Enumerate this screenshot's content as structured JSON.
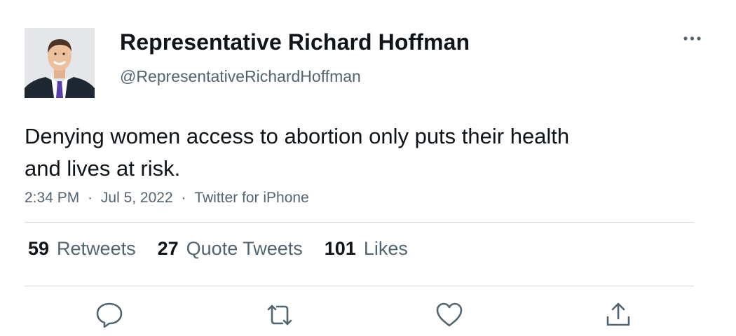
{
  "tweet": {
    "author": {
      "display_name": "Representative Richard Hoffman",
      "handle": "@RepresentativeRichardHoffman"
    },
    "text": "Denying women access to abortion only puts their health and lives at risk.",
    "time": "2:34 PM",
    "separator": "·",
    "date": "Jul 5, 2022",
    "source": "Twitter for iPhone",
    "stats": [
      {
        "count": "59",
        "label": "Retweets"
      },
      {
        "count": "27",
        "label": "Quote Tweets"
      },
      {
        "count": "101",
        "label": "Likes"
      }
    ],
    "actions": [
      "reply-icon",
      "retweet-icon",
      "like-icon",
      "share-icon"
    ]
  },
  "colors": {
    "text_primary": "#0f1419",
    "text_secondary": "#536471",
    "divider": "#cfd9de",
    "tie": "#5b3fa8",
    "suit": "#1f2733"
  }
}
